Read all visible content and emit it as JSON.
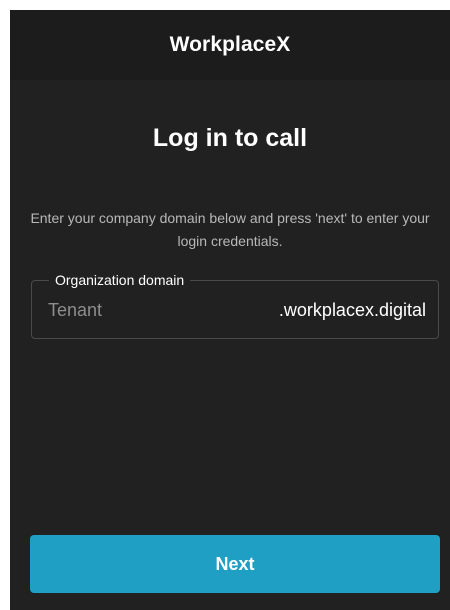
{
  "app": {
    "title": "WorkplaceX"
  },
  "login": {
    "heading": "Log in to call",
    "instructions": "Enter your company domain below and press 'next' to enter your login credentials.",
    "domain_field": {
      "label": "Organization domain",
      "placeholder": "Tenant",
      "value": "",
      "suffix": ".workplacex.digital"
    },
    "next_label": "Next"
  },
  "colors": {
    "background": "#212121",
    "titlebar": "#1c1c1c",
    "accent": "#1f9fc4",
    "field_border": "#4a4a4a",
    "muted_text": "#b8b8b8"
  }
}
